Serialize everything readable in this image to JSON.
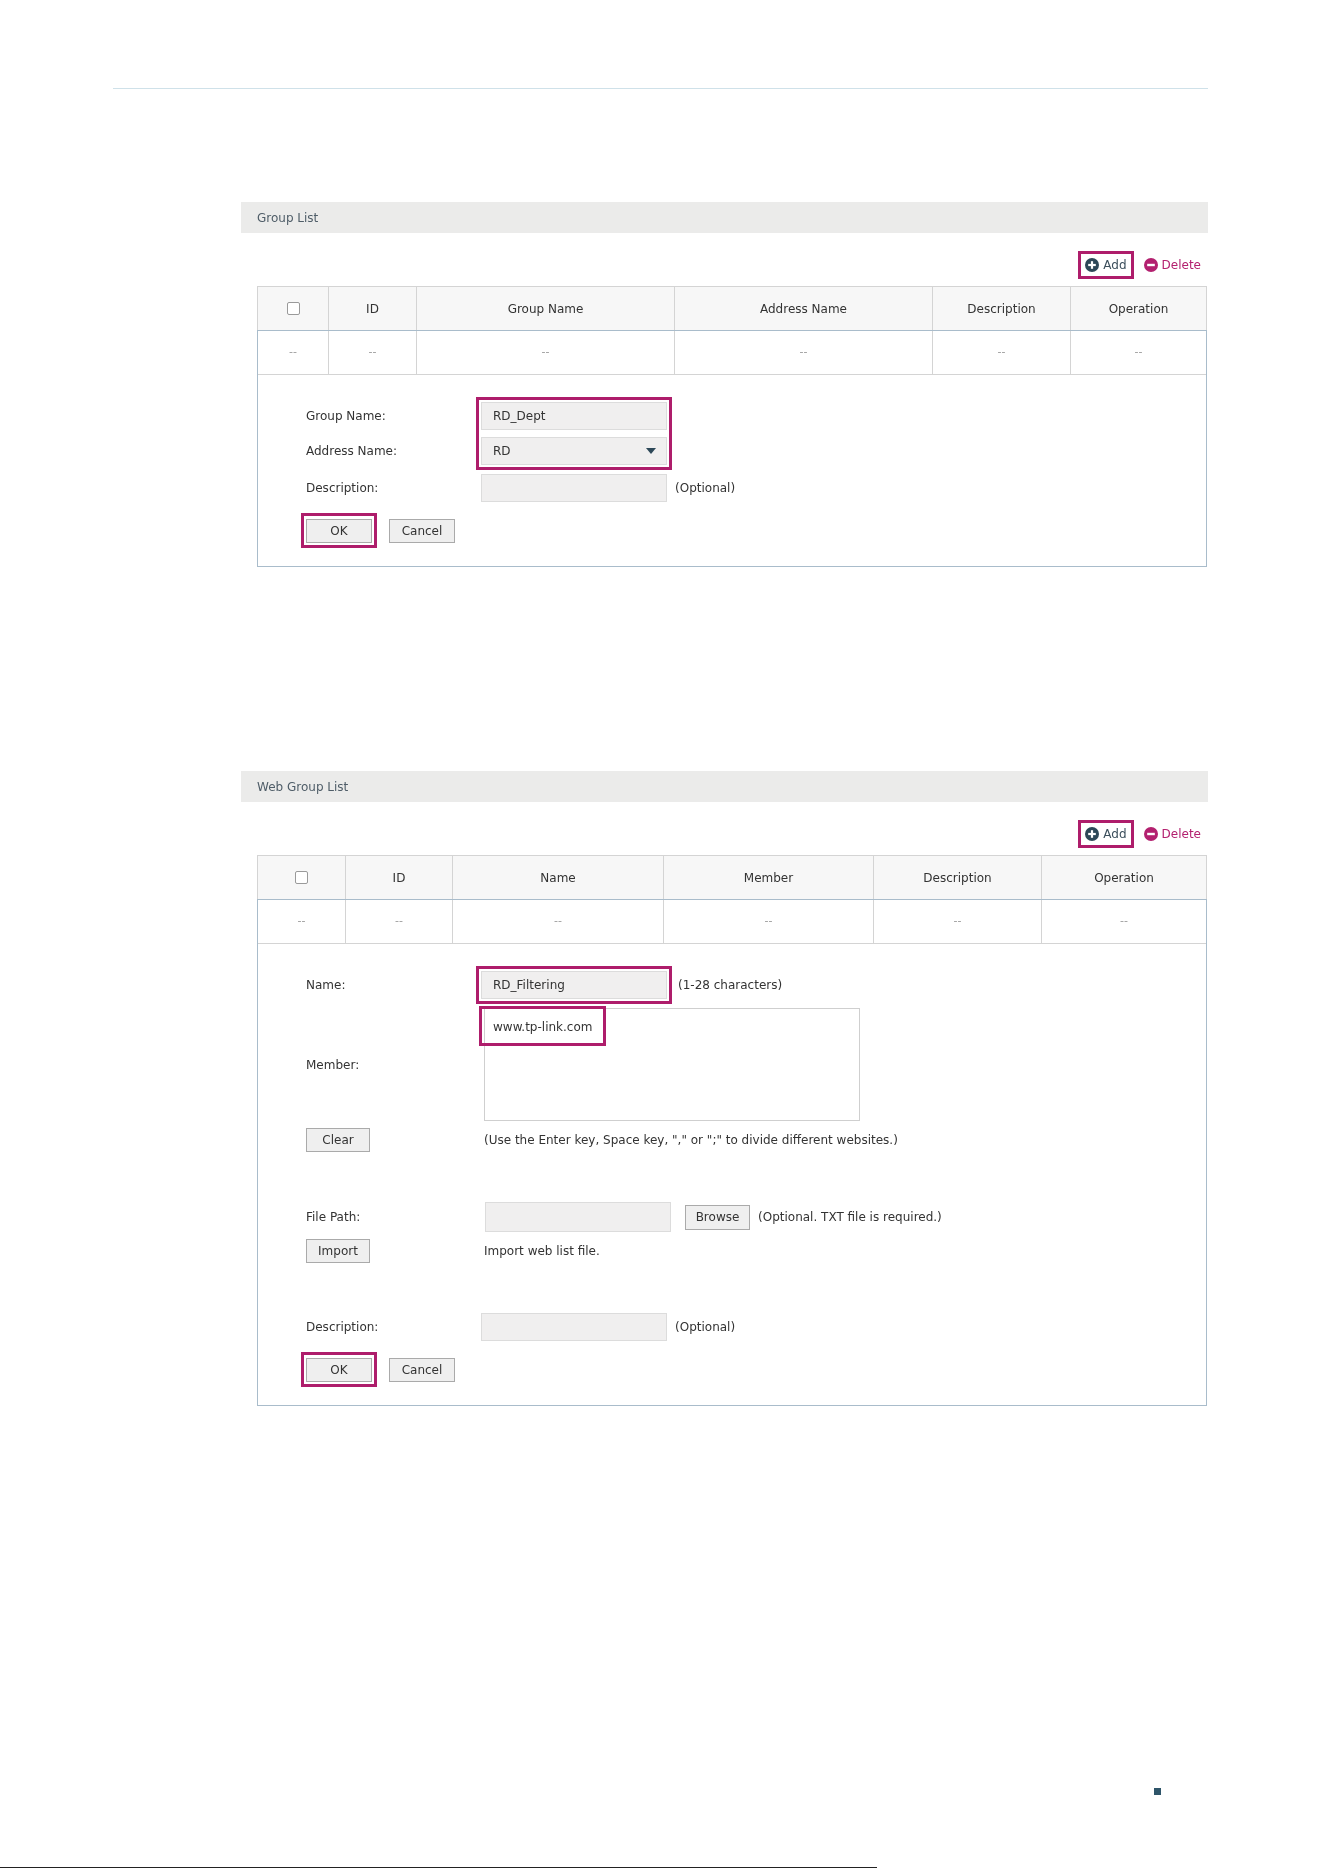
{
  "panels": [
    {
      "title": "Group List",
      "toolbar": [
        {
          "kind": "add",
          "label": "Add",
          "highlighted": true
        },
        {
          "kind": "delete",
          "label": "Delete",
          "highlighted": false
        }
      ],
      "table": {
        "columns": [
          {
            "kind": "checkbox",
            "checked": false
          },
          {
            "kind": "text",
            "label": "ID"
          },
          {
            "kind": "text",
            "label": "Group Name"
          },
          {
            "kind": "text",
            "label": "Address Name"
          },
          {
            "kind": "text",
            "label": "Description"
          },
          {
            "kind": "text",
            "label": "Operation"
          }
        ],
        "rows": [
          [
            "--",
            "--",
            "--",
            "--",
            "--",
            "--"
          ]
        ]
      },
      "form": {
        "rows": [
          {
            "kind": "input",
            "label": "Group Name:",
            "value": "RD_Dept",
            "highlighted": true
          },
          {
            "kind": "select",
            "label": "Address Name:",
            "value": "RD",
            "highlighted": true
          },
          {
            "kind": "input",
            "label": "Description:",
            "hint": "(Optional)",
            "highlighted": false
          }
        ],
        "buttons": [
          {
            "label": "OK",
            "highlighted": true
          },
          {
            "label": "Cancel",
            "highlighted": false
          }
        ]
      }
    },
    {
      "title": "Web Group List",
      "toolbar": [
        {
          "kind": "add",
          "label": "Add",
          "highlighted": true
        },
        {
          "kind": "delete",
          "label": "Delete",
          "highlighted": false
        }
      ],
      "table": {
        "columns": [
          {
            "kind": "checkbox",
            "checked": false
          },
          {
            "kind": "text",
            "label": "ID"
          },
          {
            "kind": "text",
            "label": "Name"
          },
          {
            "kind": "text",
            "label": "Member"
          },
          {
            "kind": "text",
            "label": "Description"
          },
          {
            "kind": "text",
            "label": "Operation"
          }
        ],
        "rows": [
          [
            "--",
            "--",
            "--",
            "--",
            "--",
            "--"
          ]
        ]
      },
      "form": {
        "rows": [
          {
            "kind": "input",
            "label": "Name:",
            "value": "RD_Filtering",
            "hint": "(1-28 characters)",
            "highlighted": true
          },
          {
            "kind": "textarea",
            "label": "Member:",
            "entries": [
              {
                "text": "www.tp-link.com",
                "highlighted": true
              }
            ],
            "highlighted": false
          },
          {
            "kind": "button_hint",
            "button": "Clear",
            "hint": "(Use the Enter key, Space key, \",\" or \";\" to divide different websites.)",
            "highlighted": false
          },
          {
            "kind": "file",
            "label": "File Path:",
            "button": "Browse",
            "hint": "(Optional. TXT file is required.)",
            "highlighted": false
          },
          {
            "kind": "button_hint",
            "button": "Import",
            "hint": "Import web list file.",
            "highlighted": false
          },
          {
            "kind": "input",
            "label": "Description:",
            "hint": "(Optional)",
            "highlighted": false
          }
        ],
        "buttons": [
          {
            "label": "OK",
            "highlighted": true
          },
          {
            "label": "Cancel",
            "highlighted": false
          }
        ]
      }
    }
  ]
}
